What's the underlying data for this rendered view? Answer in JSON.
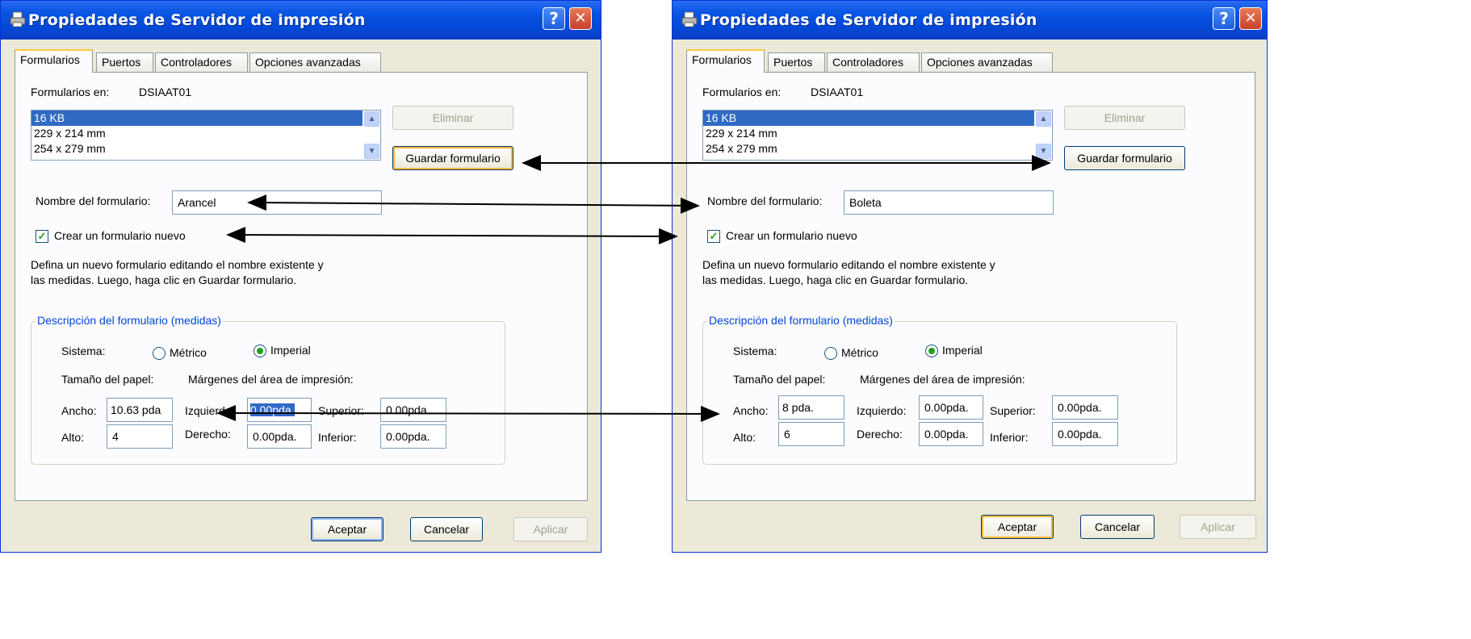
{
  "dialogs": [
    {
      "title": "Propiedades de Servidor de impresión",
      "help_glyph": "?",
      "close_glyph": "✕",
      "tabs": [
        "Formularios",
        "Puertos",
        "Controladores",
        "Opciones avanzadas"
      ],
      "forms_on_label": "Formularios en:",
      "server_name": "DSIAAT01",
      "forms_list": [
        "16 KB",
        "229 x 214 mm",
        "254 x 279 mm"
      ],
      "delete_button": "Eliminar",
      "save_button": "Guardar formulario",
      "form_name_label": "Nombre del formulario:",
      "form_name_value": "Arancel",
      "create_new_label": "Crear un formulario nuevo",
      "create_new_checked": true,
      "help_line1": "Defina un nuevo formulario editando el nombre existente y",
      "help_line2": "las medidas. Luego, haga clic en Guardar formulario.",
      "group_title": "Descripción del formulario (medidas)",
      "system_label": "Sistema:",
      "metric_label": "Métrico",
      "imperial_label": "Imperial",
      "selected_system": "Imperial",
      "paper_size_label": "Tamaño del papel:",
      "margins_label": "Márgenes del área de impresión:",
      "width_label": "Ancho:",
      "width_value": "10.63 pda",
      "height_label": "Alto:",
      "height_value": "4",
      "left_label": "Izquierdo:",
      "left_value": "0.00pda.",
      "right_label": "Derecho:",
      "right_value": "0.00pda.",
      "top_label": "Superior:",
      "top_value": "0.00pda.",
      "bottom_label": "Inferior:",
      "bottom_value": "0.00pda.",
      "ok_button": "Aceptar",
      "cancel_button": "Cancelar",
      "apply_button": "Aplicar"
    },
    {
      "title": "Propiedades de Servidor de impresión",
      "help_glyph": "?",
      "close_glyph": "✕",
      "tabs": [
        "Formularios",
        "Puertos",
        "Controladores",
        "Opciones avanzadas"
      ],
      "forms_on_label": "Formularios en:",
      "server_name": "DSIAAT01",
      "forms_list": [
        "16 KB",
        "229 x 214 mm",
        "254 x 279 mm"
      ],
      "delete_button": "Eliminar",
      "save_button": "Guardar formulario",
      "form_name_label": "Nombre del formulario:",
      "form_name_value": "Boleta",
      "create_new_label": "Crear un formulario nuevo",
      "create_new_checked": true,
      "help_line1": "Defina un nuevo formulario editando el nombre existente y",
      "help_line2": "las medidas. Luego, haga clic en Guardar formulario.",
      "group_title": "Descripción del formulario (medidas)",
      "system_label": "Sistema:",
      "metric_label": "Métrico",
      "imperial_label": "Imperial",
      "selected_system": "Imperial",
      "paper_size_label": "Tamaño del papel:",
      "margins_label": "Márgenes del área de impresión:",
      "width_label": "Ancho:",
      "width_value": "8 pda.",
      "height_label": "Alto:",
      "height_value": "6",
      "left_label": "Izquierdo:",
      "left_value": "0.00pda.",
      "right_label": "Derecho:",
      "right_value": "0.00pda.",
      "top_label": "Superior:",
      "top_value": "0.00pda.",
      "bottom_label": "Inferior:",
      "bottom_value": "0.00pda.",
      "ok_button": "Aceptar",
      "cancel_button": "Cancelar",
      "apply_button": "Aplicar"
    }
  ],
  "colors": {
    "titlebar": "#0a55e3",
    "dialog_face": "#ece9d8",
    "selection": "#316ac5",
    "group_title": "#0046d5",
    "check_green": "#21a121"
  },
  "annotation": "double-headed arrows linking the changed fields between the two dialogs"
}
